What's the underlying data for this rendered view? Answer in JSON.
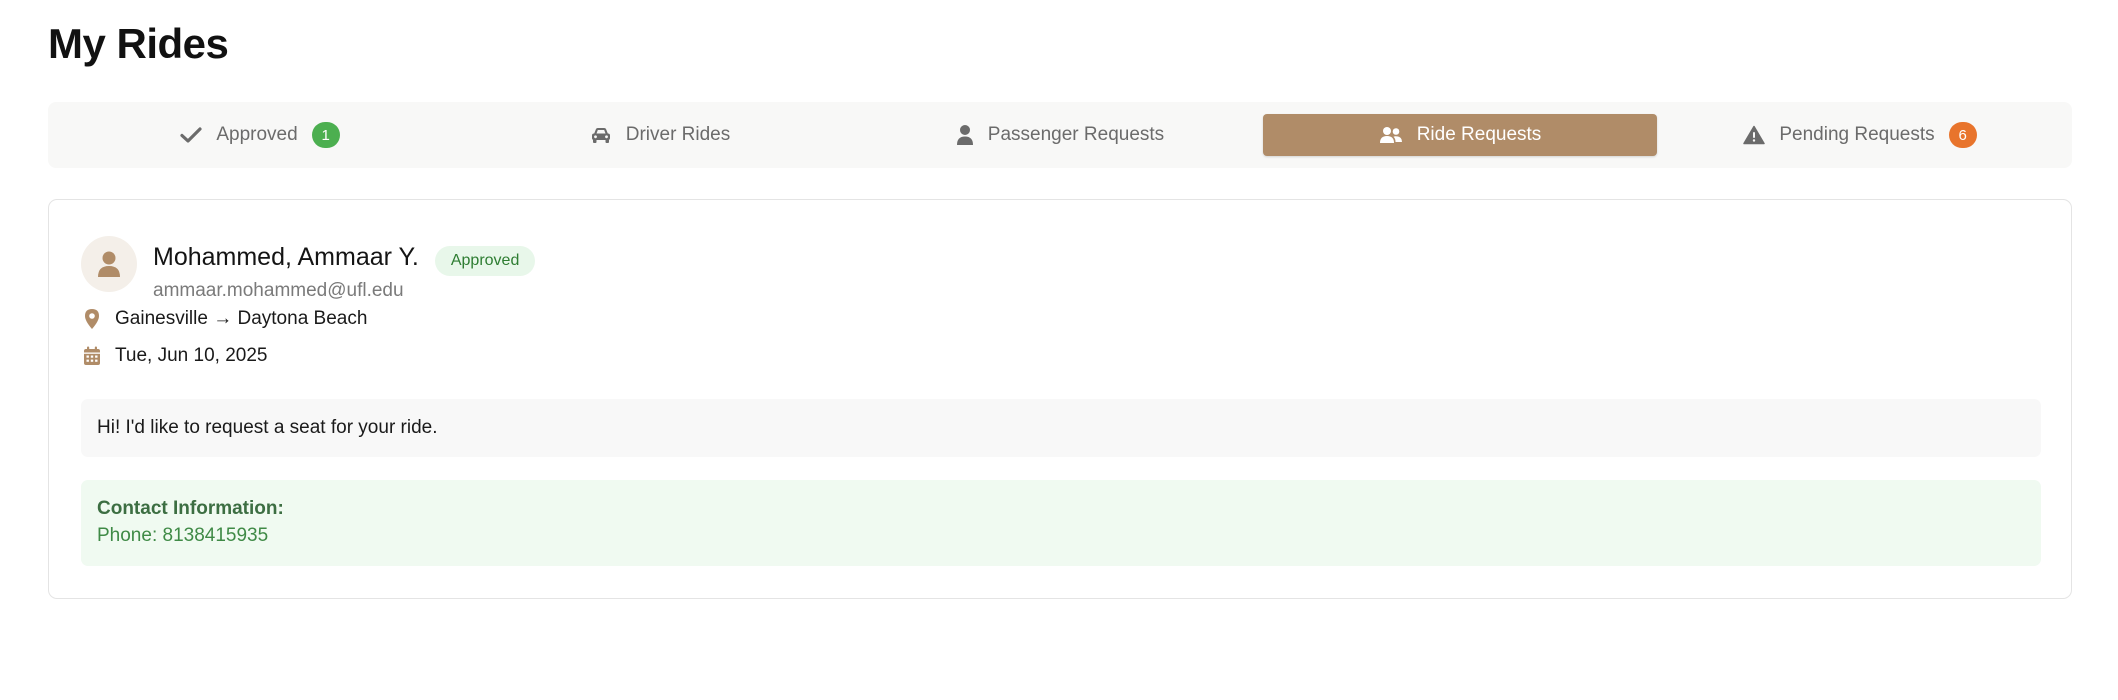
{
  "page": {
    "title": "My Rides"
  },
  "tabs": [
    {
      "label": "Approved",
      "icon": "check-icon",
      "badge": "1",
      "badge_color": "#4caf50",
      "active": false
    },
    {
      "label": "Driver Rides",
      "icon": "car-icon",
      "badge": null,
      "active": false
    },
    {
      "label": "Passenger Requests",
      "icon": "user-icon",
      "badge": null,
      "active": false
    },
    {
      "label": "Ride Requests",
      "icon": "users-icon",
      "badge": null,
      "active": true
    },
    {
      "label": "Pending Requests",
      "icon": "warning-icon",
      "badge": "6",
      "badge_color": "#e8742c",
      "active": false
    }
  ],
  "request": {
    "name": "Mohammed, Ammaar Y.",
    "email": "ammaar.mohammed@ufl.edu",
    "status": "Approved",
    "route": "Gainesville → Daytona Beach",
    "date": "Tue, Jun 10, 2025",
    "message": "Hi! I'd like to request a seat for your ride.",
    "contact_title": "Contact Information:",
    "contact_phone": "Phone: 8138415935"
  },
  "colors": {
    "accent": "#b08c68",
    "approved_bg": "#e8f7ea",
    "approved_text": "#2e7d32",
    "contact_bg": "#f0faf1"
  }
}
